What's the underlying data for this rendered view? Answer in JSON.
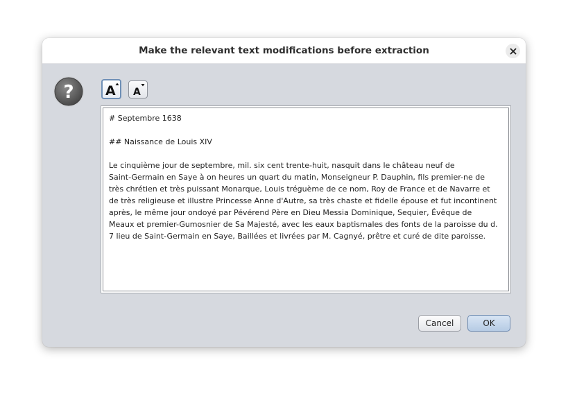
{
  "dialog": {
    "title": "Make the relevant text modifications before extraction",
    "close_icon": "close-icon",
    "question_icon": "question-icon"
  },
  "toolbar": {
    "increase_font_label": "A",
    "decrease_font_label": "A"
  },
  "editor": {
    "lines": [
      "# Septembre 1638",
      "",
      "## Naissance de Louis XIV",
      "",
      "Le cinquième jour de septembre, mil. six cent trente-huit, nasquit dans le château neuf de",
      "Saint-Germain en Saye à on heures un quart du matin, Monseigneur P. Dauphin, fils premier-ne de",
      "très chrétien et très puissant Monarque, Louis tréguème de ce nom, Roy de France et de Navarre et",
      "de très religieuse et illustre Princesse Anne d'Autre, sa très chaste et fidelle épouse et fut incontinent",
      "après, le même jour ondoyé par Pévérend Père en Dieu Messia Dominique, Sequier, Évêque de",
      "Meaux et premier-Gumosnier de Sa Majesté, avec les eaux baptismales des fonts de la paroisse du d.",
      "7 lieu de Saint-Germain en Saye, Baillées et livrées par M. Cagnyé, prêtre et curé de dite paroisse."
    ]
  },
  "buttons": {
    "cancel_label": "Cancel",
    "ok_label": "OK"
  },
  "colors": {
    "dialog_bg": "#d6d9df",
    "titlebar_bg": "#ffffff",
    "ok_button": "#b6cbe4",
    "focus_border": "#6e8fb6"
  }
}
